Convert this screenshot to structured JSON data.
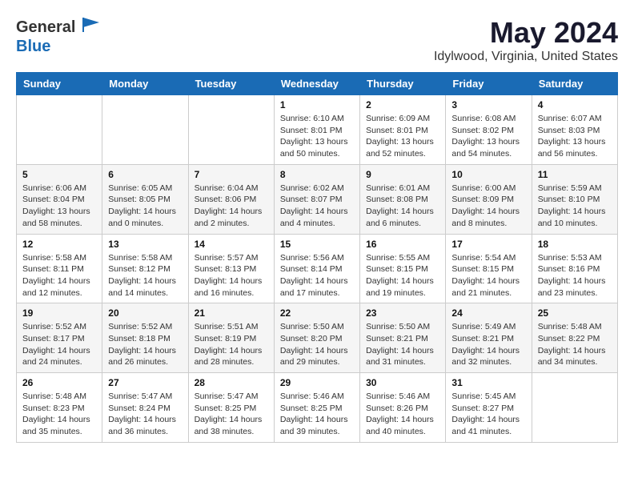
{
  "header": {
    "logo": {
      "line1": "General",
      "line2": "Blue"
    },
    "title": "May 2024",
    "subtitle": "Idylwood, Virginia, United States"
  },
  "weekdays": [
    "Sunday",
    "Monday",
    "Tuesday",
    "Wednesday",
    "Thursday",
    "Friday",
    "Saturday"
  ],
  "weeks": [
    [
      {
        "day": "",
        "info": ""
      },
      {
        "day": "",
        "info": ""
      },
      {
        "day": "",
        "info": ""
      },
      {
        "day": "1",
        "info": "Sunrise: 6:10 AM\nSunset: 8:01 PM\nDaylight: 13 hours\nand 50 minutes."
      },
      {
        "day": "2",
        "info": "Sunrise: 6:09 AM\nSunset: 8:01 PM\nDaylight: 13 hours\nand 52 minutes."
      },
      {
        "day": "3",
        "info": "Sunrise: 6:08 AM\nSunset: 8:02 PM\nDaylight: 13 hours\nand 54 minutes."
      },
      {
        "day": "4",
        "info": "Sunrise: 6:07 AM\nSunset: 8:03 PM\nDaylight: 13 hours\nand 56 minutes."
      }
    ],
    [
      {
        "day": "5",
        "info": "Sunrise: 6:06 AM\nSunset: 8:04 PM\nDaylight: 13 hours\nand 58 minutes."
      },
      {
        "day": "6",
        "info": "Sunrise: 6:05 AM\nSunset: 8:05 PM\nDaylight: 14 hours\nand 0 minutes."
      },
      {
        "day": "7",
        "info": "Sunrise: 6:04 AM\nSunset: 8:06 PM\nDaylight: 14 hours\nand 2 minutes."
      },
      {
        "day": "8",
        "info": "Sunrise: 6:02 AM\nSunset: 8:07 PM\nDaylight: 14 hours\nand 4 minutes."
      },
      {
        "day": "9",
        "info": "Sunrise: 6:01 AM\nSunset: 8:08 PM\nDaylight: 14 hours\nand 6 minutes."
      },
      {
        "day": "10",
        "info": "Sunrise: 6:00 AM\nSunset: 8:09 PM\nDaylight: 14 hours\nand 8 minutes."
      },
      {
        "day": "11",
        "info": "Sunrise: 5:59 AM\nSunset: 8:10 PM\nDaylight: 14 hours\nand 10 minutes."
      }
    ],
    [
      {
        "day": "12",
        "info": "Sunrise: 5:58 AM\nSunset: 8:11 PM\nDaylight: 14 hours\nand 12 minutes."
      },
      {
        "day": "13",
        "info": "Sunrise: 5:58 AM\nSunset: 8:12 PM\nDaylight: 14 hours\nand 14 minutes."
      },
      {
        "day": "14",
        "info": "Sunrise: 5:57 AM\nSunset: 8:13 PM\nDaylight: 14 hours\nand 16 minutes."
      },
      {
        "day": "15",
        "info": "Sunrise: 5:56 AM\nSunset: 8:14 PM\nDaylight: 14 hours\nand 17 minutes."
      },
      {
        "day": "16",
        "info": "Sunrise: 5:55 AM\nSunset: 8:15 PM\nDaylight: 14 hours\nand 19 minutes."
      },
      {
        "day": "17",
        "info": "Sunrise: 5:54 AM\nSunset: 8:15 PM\nDaylight: 14 hours\nand 21 minutes."
      },
      {
        "day": "18",
        "info": "Sunrise: 5:53 AM\nSunset: 8:16 PM\nDaylight: 14 hours\nand 23 minutes."
      }
    ],
    [
      {
        "day": "19",
        "info": "Sunrise: 5:52 AM\nSunset: 8:17 PM\nDaylight: 14 hours\nand 24 minutes."
      },
      {
        "day": "20",
        "info": "Sunrise: 5:52 AM\nSunset: 8:18 PM\nDaylight: 14 hours\nand 26 minutes."
      },
      {
        "day": "21",
        "info": "Sunrise: 5:51 AM\nSunset: 8:19 PM\nDaylight: 14 hours\nand 28 minutes."
      },
      {
        "day": "22",
        "info": "Sunrise: 5:50 AM\nSunset: 8:20 PM\nDaylight: 14 hours\nand 29 minutes."
      },
      {
        "day": "23",
        "info": "Sunrise: 5:50 AM\nSunset: 8:21 PM\nDaylight: 14 hours\nand 31 minutes."
      },
      {
        "day": "24",
        "info": "Sunrise: 5:49 AM\nSunset: 8:21 PM\nDaylight: 14 hours\nand 32 minutes."
      },
      {
        "day": "25",
        "info": "Sunrise: 5:48 AM\nSunset: 8:22 PM\nDaylight: 14 hours\nand 34 minutes."
      }
    ],
    [
      {
        "day": "26",
        "info": "Sunrise: 5:48 AM\nSunset: 8:23 PM\nDaylight: 14 hours\nand 35 minutes."
      },
      {
        "day": "27",
        "info": "Sunrise: 5:47 AM\nSunset: 8:24 PM\nDaylight: 14 hours\nand 36 minutes."
      },
      {
        "day": "28",
        "info": "Sunrise: 5:47 AM\nSunset: 8:25 PM\nDaylight: 14 hours\nand 38 minutes."
      },
      {
        "day": "29",
        "info": "Sunrise: 5:46 AM\nSunset: 8:25 PM\nDaylight: 14 hours\nand 39 minutes."
      },
      {
        "day": "30",
        "info": "Sunrise: 5:46 AM\nSunset: 8:26 PM\nDaylight: 14 hours\nand 40 minutes."
      },
      {
        "day": "31",
        "info": "Sunrise: 5:45 AM\nSunset: 8:27 PM\nDaylight: 14 hours\nand 41 minutes."
      },
      {
        "day": "",
        "info": ""
      }
    ]
  ]
}
